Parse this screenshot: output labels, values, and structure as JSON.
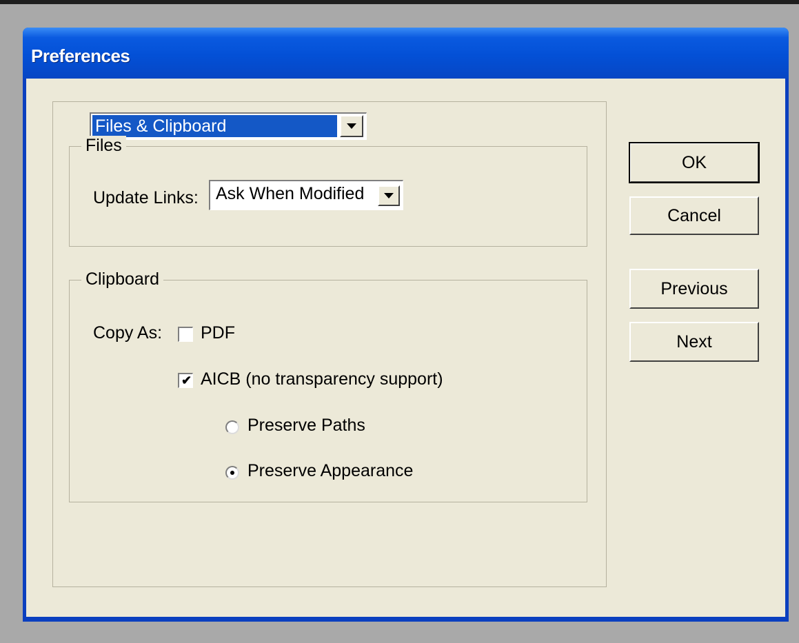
{
  "window": {
    "title": "Preferences"
  },
  "category_select": {
    "value": "Files & Clipboard"
  },
  "files_group": {
    "legend": "Files",
    "update_links_label": "Update Links:",
    "update_links_value": "Ask When Modified"
  },
  "clipboard_group": {
    "legend": "Clipboard",
    "copy_as_label": "Copy As:",
    "pdf": {
      "label": "PDF",
      "checked": false
    },
    "aicb": {
      "label": "AICB (no transparency support)",
      "checked": true
    },
    "preserve_paths": {
      "label": "Preserve Paths",
      "selected": false
    },
    "preserve_appearance": {
      "label": "Preserve Appearance",
      "selected": true
    }
  },
  "buttons": {
    "ok": "OK",
    "cancel": "Cancel",
    "previous": "Previous",
    "next": "Next"
  },
  "colors": {
    "titlebar": "#0350d6",
    "dialog_bg": "#ece9d8",
    "selection": "#1458c6"
  },
  "icons": {
    "dropdown": "chevron-down-icon",
    "check": "check-icon"
  }
}
